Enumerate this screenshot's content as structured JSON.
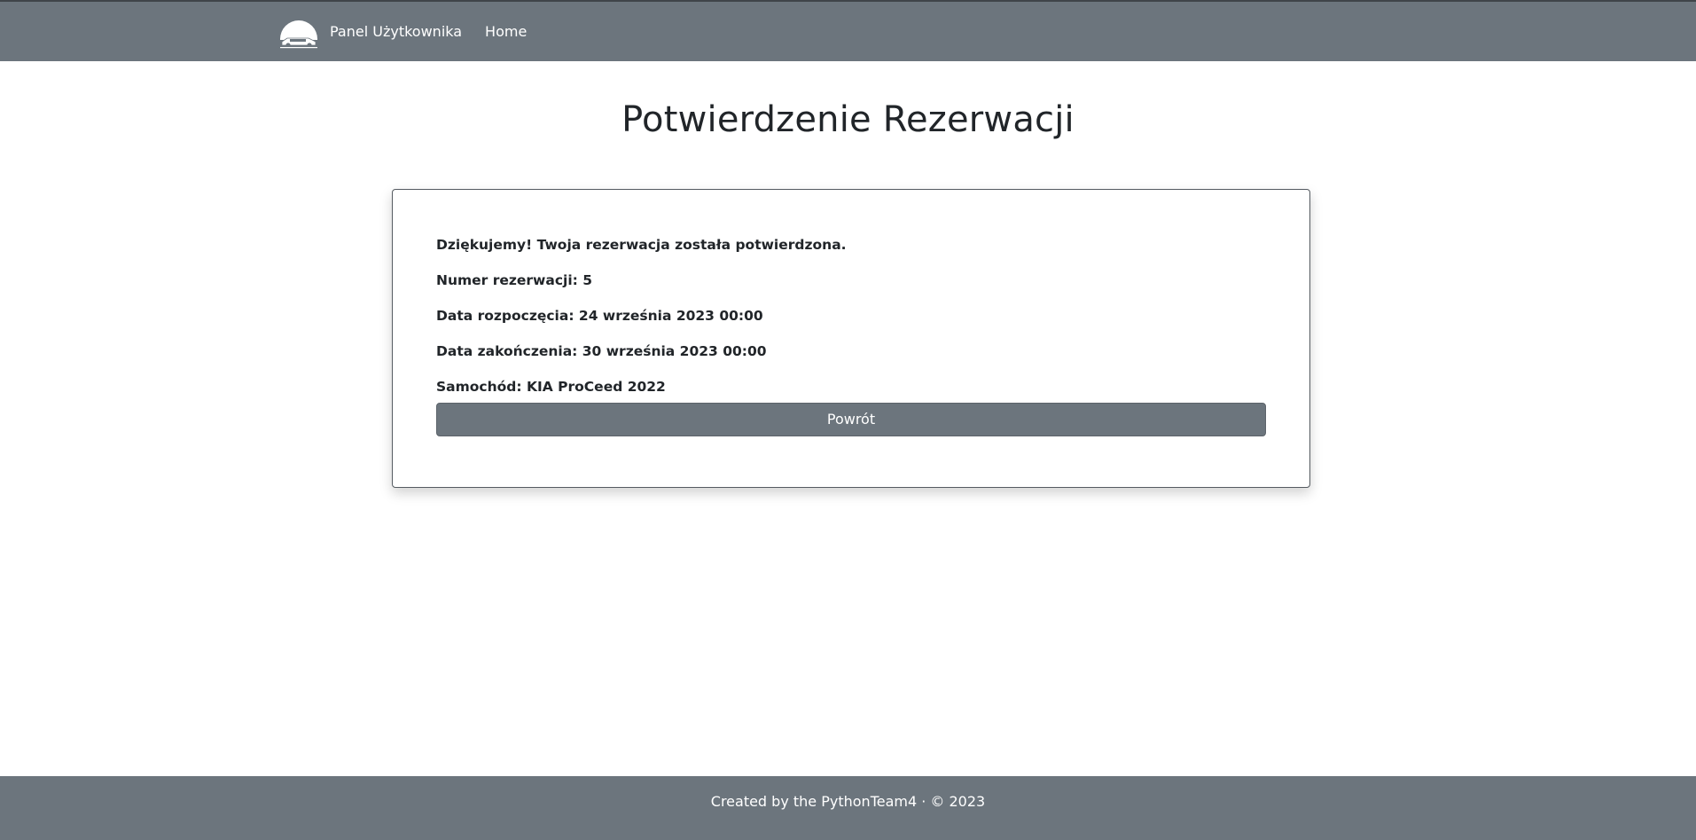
{
  "navbar": {
    "logo_icon": "car-logo-icon",
    "user_panel_label": "Panel Użytkownika",
    "home_label": "Home",
    "background_color": "#6c757d"
  },
  "main": {
    "title": "Potwierdzenie Rezerwacji",
    "confirmation": {
      "thank_you": "Dziękujemy! Twoja rezerwacja została potwierdzona.",
      "reservation_number": "Numer rezerwacji: 5",
      "start_date": "Data rozpoczęcia: 24 września 2023 00:00",
      "end_date": "Data zakończenia: 30 września 2023 00:00",
      "car": "Samochód: KIA ProCeed 2022"
    },
    "back_button_label": "Powrót"
  },
  "footer": {
    "text": "Created by the PythonTeam4 · © 2023"
  }
}
